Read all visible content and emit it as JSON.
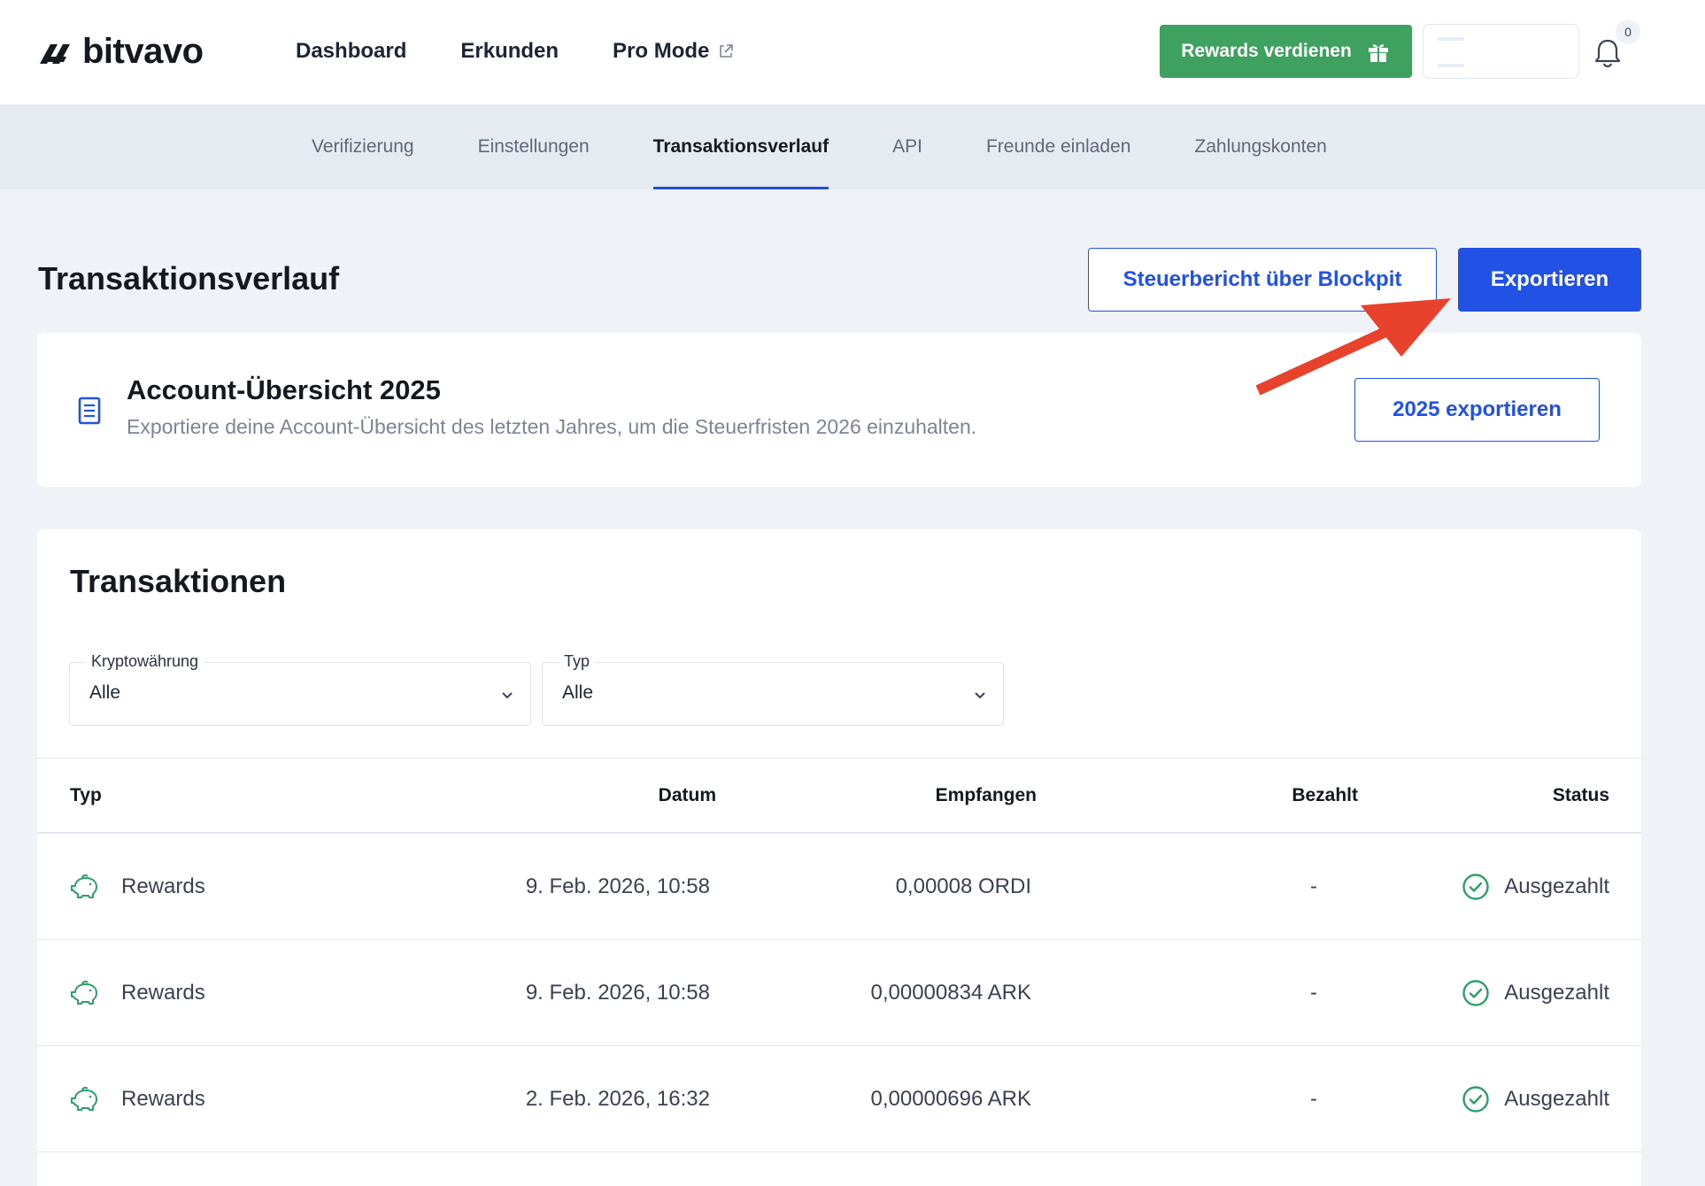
{
  "brand": {
    "name": "bitvavo"
  },
  "nav": {
    "items": [
      {
        "label": "Dashboard"
      },
      {
        "label": "Erkunden"
      },
      {
        "label": "Pro Mode"
      }
    ]
  },
  "header": {
    "rewards_label": "Rewards verdienen",
    "notification_count": "0"
  },
  "subnav": {
    "items": [
      {
        "label": "Verifizierung"
      },
      {
        "label": "Einstellungen"
      },
      {
        "label": "Transaktionsverlauf",
        "active": true
      },
      {
        "label": "API"
      },
      {
        "label": "Freunde einladen"
      },
      {
        "label": "Zahlungskonten"
      }
    ]
  },
  "page": {
    "title": "Transaktionsverlauf",
    "tax_report_label": "Steuerbericht über Blockpit",
    "export_label": "Exportieren"
  },
  "overview": {
    "title": "Account-Übersicht 2025",
    "description": "Exportiere deine Account-Übersicht des letzten Jahres, um die Steuerfristen 2026 einzuhalten.",
    "export_label": "2025 exportieren"
  },
  "transactions": {
    "title": "Transaktionen",
    "filters": {
      "crypto": {
        "label": "Kryptowährung",
        "value": "Alle"
      },
      "type": {
        "label": "Typ",
        "value": "Alle"
      }
    },
    "columns": [
      "Typ",
      "Datum",
      "Empfangen",
      "Bezahlt",
      "Status"
    ],
    "rows": [
      {
        "type": "Rewards",
        "date": "9. Feb. 2026, 10:58",
        "received": "0,00008 ORDI",
        "paid": "-",
        "status": "Ausgezahlt"
      },
      {
        "type": "Rewards",
        "date": "9. Feb. 2026, 10:58",
        "received": "0,00000834 ARK",
        "paid": "-",
        "status": "Ausgezahlt"
      },
      {
        "type": "Rewards",
        "date": "2. Feb. 2026, 16:32",
        "received": "0,00000696 ARK",
        "paid": "-",
        "status": "Ausgezahlt"
      }
    ]
  },
  "colors": {
    "primary": "#2251e6",
    "rewards_green": "#3ea160",
    "status_green": "#2e9e6b",
    "annotation_arrow": "#e8412c"
  }
}
